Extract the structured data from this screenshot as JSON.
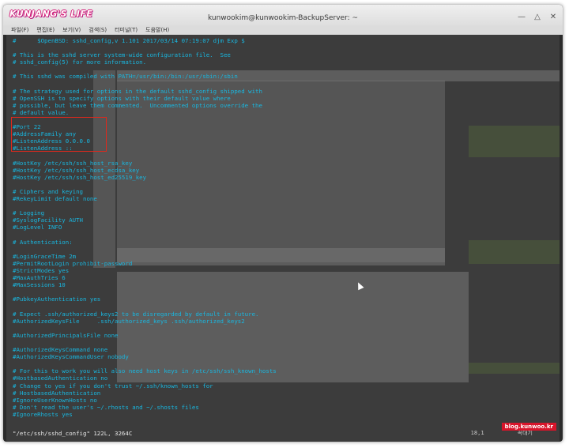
{
  "window": {
    "logo_text": "KUNJANG'S LIFE",
    "title": "kunwookim@kunwookim-BackupServer: ~",
    "controls": [
      "minimize",
      "maximize",
      "close"
    ]
  },
  "menu": [
    "파일(F)",
    "편집(E)",
    "보기(V)",
    "검색(S)",
    "터미널(T)",
    "도움말(H)"
  ],
  "terminal": {
    "text_color": "#19b7e0",
    "lines": [
      "#      $OpenBSD: sshd_config,v 1.101 2017/03/14 07:19:07 djm Exp $",
      "",
      "# This is the sshd server system-wide configuration file.  See",
      "# sshd_config(5) for more information.",
      "",
      "# This sshd was compiled with PATH=/usr/bin:/bin:/usr/sbin:/sbin",
      "",
      "# The strategy used for options in the default sshd_config shipped with",
      "# OpenSSH is to specify options with their default value where",
      "# possible, but leave them commented.  Uncommented options override the",
      "# default value.",
      "",
      "#Port 22",
      "#AddressFamily any",
      "#ListenAddress 0.0.0.0",
      "#ListenAddress ::",
      "",
      "#HostKey /etc/ssh/ssh_host_rsa_key",
      "#HostKey /etc/ssh/ssh_host_ecdsa_key",
      "#HostKey /etc/ssh/ssh_host_ed25519_key",
      "",
      "# Ciphers and keying",
      "#RekeyLimit default none",
      "",
      "# Logging",
      "#SyslogFacility AUTH",
      "#LogLevel INFO",
      "",
      "# Authentication:",
      "",
      "#LoginGraceTime 2m",
      "#PermitRootLogin prohibit-password",
      "#StrictModes yes",
      "#MaxAuthTries 6",
      "#MaxSessions 10",
      "",
      "#PubkeyAuthentication yes",
      "",
      "# Expect .ssh/authorized_keys2 to be disregarded by default in future.",
      "#AuthorizedKeysFile     .ssh/authorized_keys .ssh/authorized_keys2",
      "",
      "#AuthorizedPrincipalsFile none",
      "",
      "#AuthorizedKeysCommand none",
      "#AuthorizedKeysCommandUser nobody",
      "",
      "# For this to work you will also need host keys in /etc/ssh/ssh_known_hosts",
      "#HostbasedAuthentication no",
      "# Change to yes if you don't trust ~/.ssh/known_hosts for",
      "# HostbasedAuthentication",
      "#IgnoreUserKnownHosts no",
      "# Don't read the user's ~/.rhosts and ~/.shosts files",
      "#IgnoreRhosts yes"
    ],
    "status_line": "\"/etc/ssh/sshd_config\" 122L, 3264C",
    "status_right": "18,1          꼭대기"
  },
  "watermark": "blog.kunwoo.kr"
}
